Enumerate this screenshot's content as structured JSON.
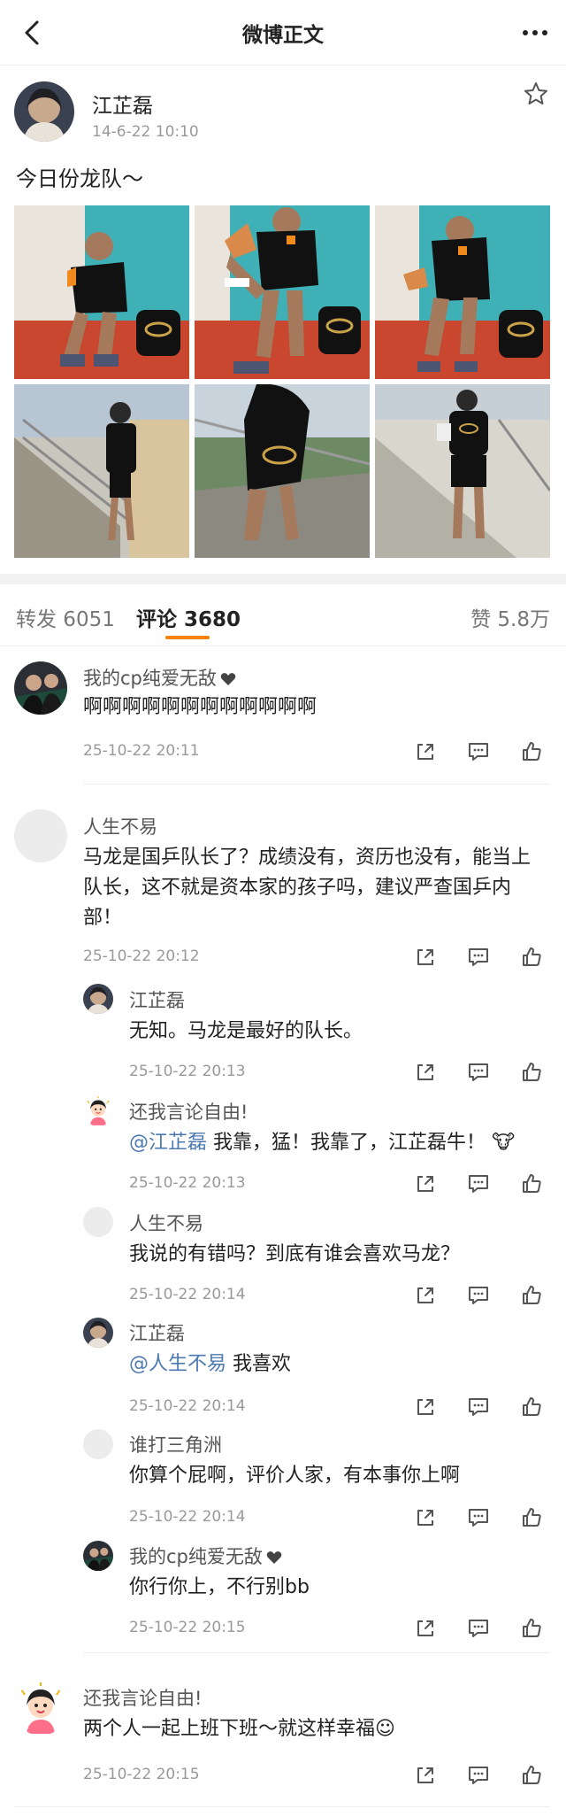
{
  "header": {
    "title": "微博正文"
  },
  "post": {
    "author": "江芷磊",
    "time": "14-6-22 10:10",
    "text": "今日份龙队～"
  },
  "tabs": {
    "reposts": "转发 6051",
    "comments": "评论 3680",
    "likes": "赞 5.8万"
  },
  "comments": [
    {
      "name": "我的cp纯爱无敌",
      "text": "啊啊啊啊啊啊啊啊啊啊啊啊",
      "time": "25-10-22 20:11"
    },
    {
      "name": "人生不易",
      "text": "马龙是国乒队长了？成绩没有，资历也没有，能当上队长，这不就是资本家的孩子吗，建议严查国乒内部！",
      "time": "25-10-22 20:12",
      "replies": [
        {
          "name": "江芷磊",
          "text": "无知。马龙是最好的队长。",
          "time": "25-10-22 20:13"
        },
        {
          "name": "还我言论自由!",
          "mention": "@江芷磊",
          "text": " 我靠，猛！我靠了，江芷磊牛！",
          "emoji": "🐮",
          "time": "25-10-22 20:13"
        },
        {
          "name": "人生不易",
          "text": "我说的有错吗？到底有谁会喜欢马龙？",
          "time": "25-10-22 20:14"
        },
        {
          "name": "江芷磊",
          "mention": "@人生不易",
          "text": " 我喜欢",
          "time": "25-10-22 20:14"
        },
        {
          "name": "谁打三角洲",
          "text": "你算个屁啊，评价人家，有本事你上啊",
          "time": "25-10-22 20:14"
        },
        {
          "name": "我的cp纯爱无敌",
          "text": "你行你上，不行别bb",
          "time": "25-10-22 20:15"
        }
      ]
    },
    {
      "name": "还我言论自由!",
      "text": "两个人一起上班下班～就这样幸福",
      "emoji": "☺",
      "time": "25-10-22 20:15"
    }
  ],
  "colors": {
    "accent": "#ff8200",
    "mention": "#4c79b0",
    "time": "#999999"
  },
  "icons": [
    "back-arrow-icon",
    "more-dots-icon",
    "star-icon",
    "share-icon",
    "comment-icon",
    "like-icon",
    "heart-icon"
  ]
}
